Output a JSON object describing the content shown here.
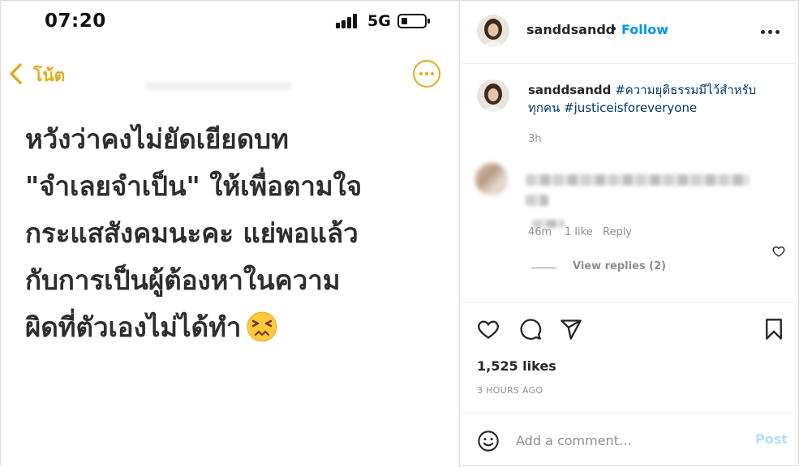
{
  "media": {
    "status_bar": {
      "time": "07:20",
      "network": "5G",
      "battery_level": 0.2
    },
    "nav": {
      "back_label": "โน้ต"
    },
    "note_lines": [
      "หวังว่าคงไม่ยัดเยียดบท",
      "\"จำเลยจำเป็น\" ให้เพื่อตามใจ",
      "กระแสสังคมนะคะ แย่พอแล้ว",
      "กับการเป็นผู้ต้องหาในความ",
      "ผิดที่ตัวเองไม่ได้ทำ"
    ],
    "emoji": "persevering-face",
    "accent_color": "#e2ac1b"
  },
  "header": {
    "username": "sanddsandd",
    "separator": "•",
    "follow_label": "Follow"
  },
  "caption": {
    "username": "sanddsandd",
    "hashtag_1": "#ความยุติธรรมมีไว้สำหรับทุกคน",
    "hashtag_2": "#justiceisforeveryone",
    "time": "3h"
  },
  "comment": {
    "time": "46m",
    "likes": "1 like",
    "reply_label": "Reply",
    "view_replies": "View replies (2)"
  },
  "post": {
    "likes": "1,525 likes",
    "posted": "3 HOURS AGO"
  },
  "add_comment": {
    "placeholder": "Add a comment…",
    "post_label": "Post"
  },
  "colors": {
    "link_blue": "#0095f6",
    "hashtag": "#00376b",
    "muted": "#8e8e8e",
    "post_disabled": "#b2dffc"
  }
}
